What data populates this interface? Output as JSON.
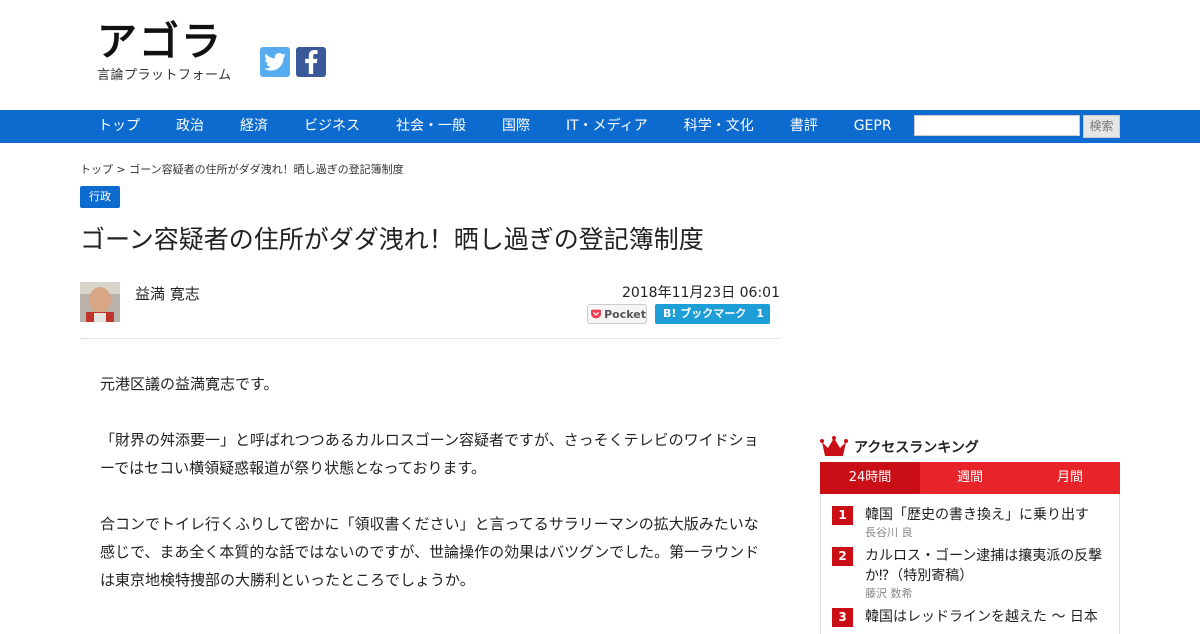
{
  "site": {
    "logo_main": "アゴラ",
    "logo_sub": "言論プラットフォーム",
    "social": [
      {
        "icon": "twitter-icon",
        "color": "#55acee"
      },
      {
        "icon": "facebook-icon",
        "color": "#3b5998"
      }
    ]
  },
  "nav": {
    "items": [
      "トップ",
      "政治",
      "経済",
      "ビジネス",
      "社会・一般",
      "国際",
      "IT・メディア",
      "科学・文化",
      "書評",
      "GEPR"
    ],
    "search_placeholder": "",
    "search_button": "検索",
    "accent_color": "#0d6bcf"
  },
  "article": {
    "breadcrumb": "トップ > ゴーン容疑者の住所がダダ洩れ！晒し過ぎの登記簿制度",
    "tag": "行政",
    "title": "ゴーン容疑者の住所がダダ洩れ！晒し過ぎの登記簿制度",
    "author": "益満 寛志",
    "date": "2018年11月23日 06:01",
    "pocket_label": "Pocket",
    "hatena_label": "B! ブックマーク",
    "hatena_count": "1",
    "paragraphs": [
      "元港区議の益満寛志です。",
      "「財界の舛添要一」と呼ばれつつあるカルロスゴーン容疑者ですが、さっそくテレビのワイドショーではセコい横領疑惑報道が祭り状態となっております。",
      "合コンでトイレ行くふりして密かに「領収書ください」と言ってるサラリーマンの拡大版みたいな感じで、まあ全く本質的な話ではないのですが、世論操作の効果はバツグンでした。第一ラウンドは東京地検特捜部の大勝利といったところでしょうか。"
    ]
  },
  "ranking": {
    "title": "アクセスランキング",
    "tabs": [
      "24時間",
      "週間",
      "月間"
    ],
    "active_tab": 0,
    "items": [
      {
        "rank": "1",
        "title": "韓国「歴史の書き換え」に乗り出す",
        "author": "長谷川 良"
      },
      {
        "rank": "2",
        "title": "カルロス・ゴーン逮捕は攘夷派の反撃か⁉（特別寄稿）",
        "author": "藤沢 数希"
      },
      {
        "rank": "3",
        "title": "韓国はレッドラインを越えた 〜 日本",
        "author": ""
      }
    ],
    "accent_color": "#e8242b"
  }
}
